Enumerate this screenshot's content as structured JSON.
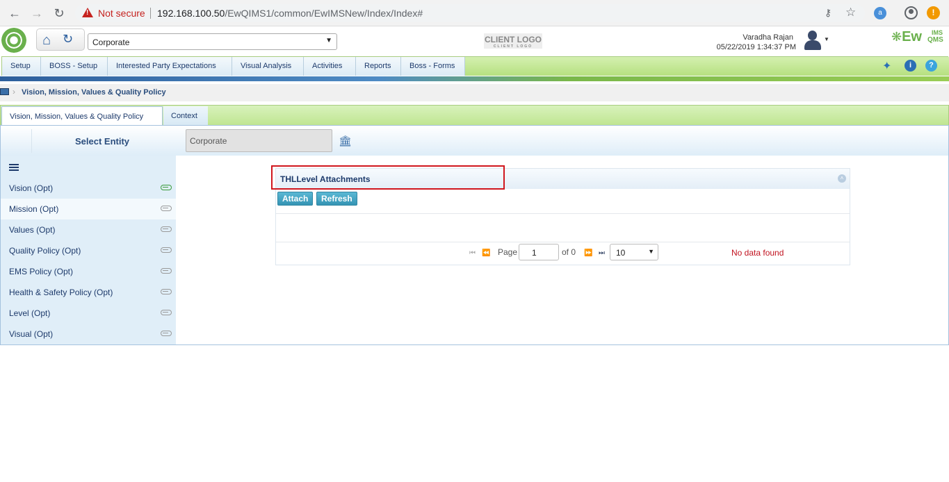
{
  "browser": {
    "not_secure": "Not secure",
    "url_host": "192.168.100.50",
    "url_path": "/EwQIMS1/common/EwIMSNew/Index/Index#"
  },
  "header": {
    "entity_value": "Corporate",
    "client_logo": "CLIENT LOGO",
    "client_logo_sub": "CLIENT LOGO",
    "user_name": "Varadha Rajan",
    "datetime": "05/22/2019 1:34:37 PM",
    "brand": "Ew",
    "brand_ims": "IMS",
    "brand_qms": "QMS"
  },
  "menu": [
    "Setup",
    "BOSS - Setup",
    "Interested Party Expectations",
    "Visual Analysis",
    "Activities",
    "Reports",
    "Boss - Forms"
  ],
  "breadcrumb": "Vision, Mission, Values & Quality Policy",
  "tabs": [
    "Vision, Mission, Values & Quality Policy",
    "Context"
  ],
  "entity": {
    "label": "Select Entity",
    "value": "Corporate"
  },
  "nav": [
    {
      "label": "Vision (Opt)"
    },
    {
      "label": "Mission (Opt)"
    },
    {
      "label": "Values (Opt)"
    },
    {
      "label": "Quality Policy (Opt)"
    },
    {
      "label": "EMS Policy (Opt)"
    },
    {
      "label": "Health & Safety Policy (Opt)"
    },
    {
      "label": "Level (Opt)"
    },
    {
      "label": "Visual (Opt)"
    }
  ],
  "attachments": {
    "title": "THLLevel Attachments",
    "attach_label": "Attach",
    "refresh_label": "Refresh",
    "page_label": "Page",
    "page_value": "1",
    "of_label": "of 0",
    "page_size": "10",
    "no_data": "No data found"
  },
  "colors": {
    "menu_green": "#b6e080",
    "nav_blue": "#e0eef8",
    "highlight_red": "#d0161d",
    "button_blue": "#3594b4",
    "no_data_red": "#c1121f"
  }
}
